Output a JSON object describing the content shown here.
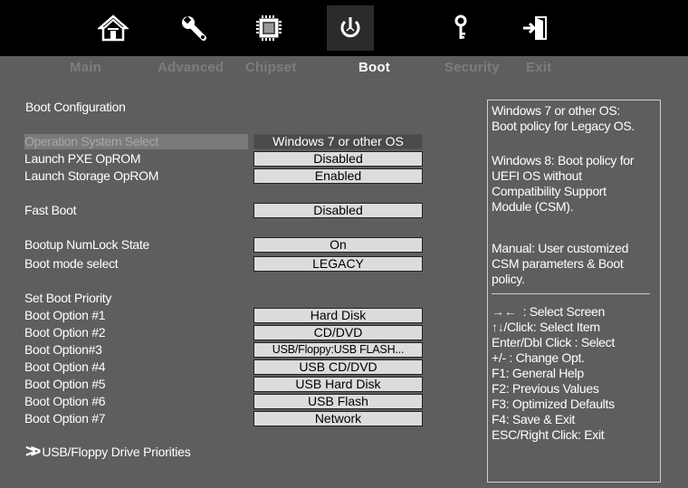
{
  "icons": [
    {
      "name": "main-home-icon"
    },
    {
      "name": "advanced-wrench-icon"
    },
    {
      "name": "chipset-chip-icon"
    },
    {
      "name": "boot-power-icon"
    },
    {
      "name": "security-key-icon"
    },
    {
      "name": "exit-door-icon"
    }
  ],
  "tabs": [
    {
      "label": "Main"
    },
    {
      "label": "Advanced"
    },
    {
      "label": "Chipset"
    },
    {
      "label": "Boot"
    },
    {
      "label": "Security"
    },
    {
      "label": "Exit"
    }
  ],
  "active_tab": "Boot",
  "boot": {
    "section_title": "Boot Configuration",
    "os_select": {
      "label": "Operation System Select",
      "value": "Windows 7 or other OS"
    },
    "pxe": {
      "label": "Launch PXE OpROM",
      "value": "Disabled"
    },
    "storage": {
      "label": "Launch Storage OpROM",
      "value": "Enabled"
    },
    "fast_boot": {
      "label": "Fast Boot",
      "value": "Disabled"
    },
    "numlock": {
      "label": "Bootup NumLock State",
      "value": "On"
    },
    "mode": {
      "label": "Boot mode select",
      "value": "LEGACY"
    },
    "priority_title": "Set Boot Priority",
    "options": [
      {
        "label": "Boot Option #1",
        "value": "Hard Disk"
      },
      {
        "label": "Boot Option #2",
        "value": "CD/DVD"
      },
      {
        "label": "Boot Option#3",
        "value": "USB/Floppy:USB  FLASH..."
      },
      {
        "label": "Boot Option #4",
        "value": "USB CD/DVD"
      },
      {
        "label": "Boot Option #5",
        "value": "USB Hard Disk"
      },
      {
        "label": "Boot Option #6",
        "value": "USB Flash"
      },
      {
        "label": "Boot Option #7",
        "value": "Network"
      }
    ],
    "submenu": "USB/Floppy Drive Priorities"
  },
  "help": {
    "p1": [
      "Windows 7 or other OS:",
      "Boot policy for Legacy OS."
    ],
    "p2": [
      "Windows 8: Boot policy for",
      "UEFI OS without",
      "Compatibility Support",
      "Module (CSM)."
    ],
    "p3": [
      "Manual: User customized",
      "CSM parameters & Boot",
      "policy."
    ],
    "keys": {
      "select_screen": ": Select Screen",
      "select_item": "/Click: Select Item",
      "enter": "Enter/Dbl Click : Select",
      "change": "+/- : Change Opt.",
      "f1": "F1: General Help",
      "f2": "F2: Previous Values",
      "f3": "F3: Optimized Defaults",
      "f4": "F4: Save & Exit",
      "esc": "ESC/Right Click: Exit"
    }
  },
  "colors": {
    "background": "#5e5e5e",
    "iconbar": "#000000",
    "value_box": "#dcdcdc",
    "selected_value": "#4a4a4a"
  }
}
